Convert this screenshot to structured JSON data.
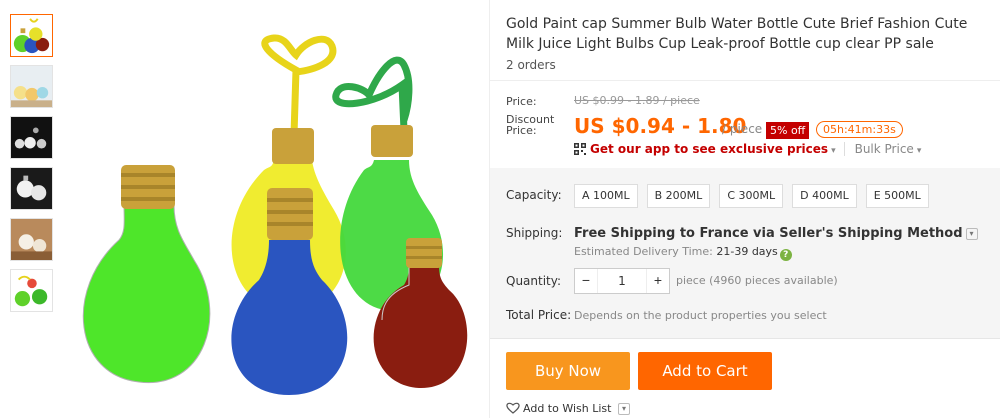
{
  "product": {
    "title": "Gold Paint cap Summer Bulb Water Bottle Cute Brief Fashion Cute Milk Juice Light Bulbs Cup Leak-proof Bottle cup clear PP sale",
    "orders": "2 orders"
  },
  "thumbnails": [
    {
      "name": "thumb-1",
      "icon": "bulb-bottles-colored"
    },
    {
      "name": "thumb-2",
      "icon": "bulb-bottles-table"
    },
    {
      "name": "thumb-3",
      "icon": "bulb-bottles-dark"
    },
    {
      "name": "thumb-4",
      "icon": "bulb-bottles-white"
    },
    {
      "name": "thumb-5",
      "icon": "bulb-bottles-wood"
    },
    {
      "name": "thumb-6",
      "icon": "bulb-bottles-green"
    }
  ],
  "price": {
    "label": "Price:",
    "original": "US $0.99 - 1.89 / piece",
    "discount_label": "Discount Price:",
    "discount": "US $0.94 - 1.80",
    "per": "/ piece",
    "off_badge": "5% off",
    "timer": "05h:41m:33s",
    "app_link": "Get our app to see exclusive prices",
    "app_caret": "▾",
    "bulk": "Bulk Price",
    "bulk_caret": "▾"
  },
  "capacity": {
    "label": "Capacity:",
    "options": [
      "A 100ML",
      "B 200ML",
      "C 300ML",
      "D 400ML",
      "E 500ML"
    ]
  },
  "shipping": {
    "label": "Shipping:",
    "main": "Free Shipping to France via Seller's Shipping Method",
    "drop": "▾",
    "estimate_prefix": "Estimated Delivery Time:",
    "estimate_days": "21-39 days",
    "help": "?"
  },
  "quantity": {
    "label": "Quantity:",
    "minus": "−",
    "value": "1",
    "plus": "+",
    "note": "piece (4960 pieces available)"
  },
  "total": {
    "label": "Total Price:",
    "value": "Depends on the product properties you select"
  },
  "actions": {
    "buy_now": "Buy Now",
    "add_to_cart": "Add to Cart",
    "wishlist": "Add to Wish List",
    "wishlist_drop": "▾"
  },
  "colors": {
    "accent": "#ff6600",
    "buy_now": "#f8961e",
    "badge": "#c40000"
  }
}
